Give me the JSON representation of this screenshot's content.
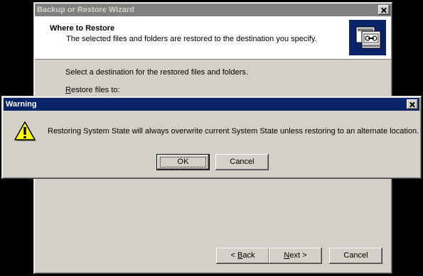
{
  "wizard": {
    "title": "Backup or Restore Wizard",
    "header_title": "Where to Restore",
    "header_subtitle": "The selected files and folders are restored to the destination you specify.",
    "body_text": "Select a destination for the restored files and folders.",
    "restore_label_first": "R",
    "restore_label_rest": "estore files to:",
    "back_underline": "B",
    "back_rest": "ack",
    "back_prefix": "<",
    "next_underline": "N",
    "next_rest": "ext",
    "next_suffix": ">",
    "cancel_label": "Cancel"
  },
  "warning": {
    "title": "Warning",
    "message": "Restoring System State will always overwrite current System State unless restoring to an alternate location.",
    "ok_label": "OK",
    "cancel_label": "Cancel"
  },
  "colors": {
    "active_title": "#0a246a",
    "inactive_title": "#808080",
    "face": "#d4d0c8"
  },
  "icons": [
    "close-icon",
    "backup-restore-icon",
    "warning-icon"
  ]
}
